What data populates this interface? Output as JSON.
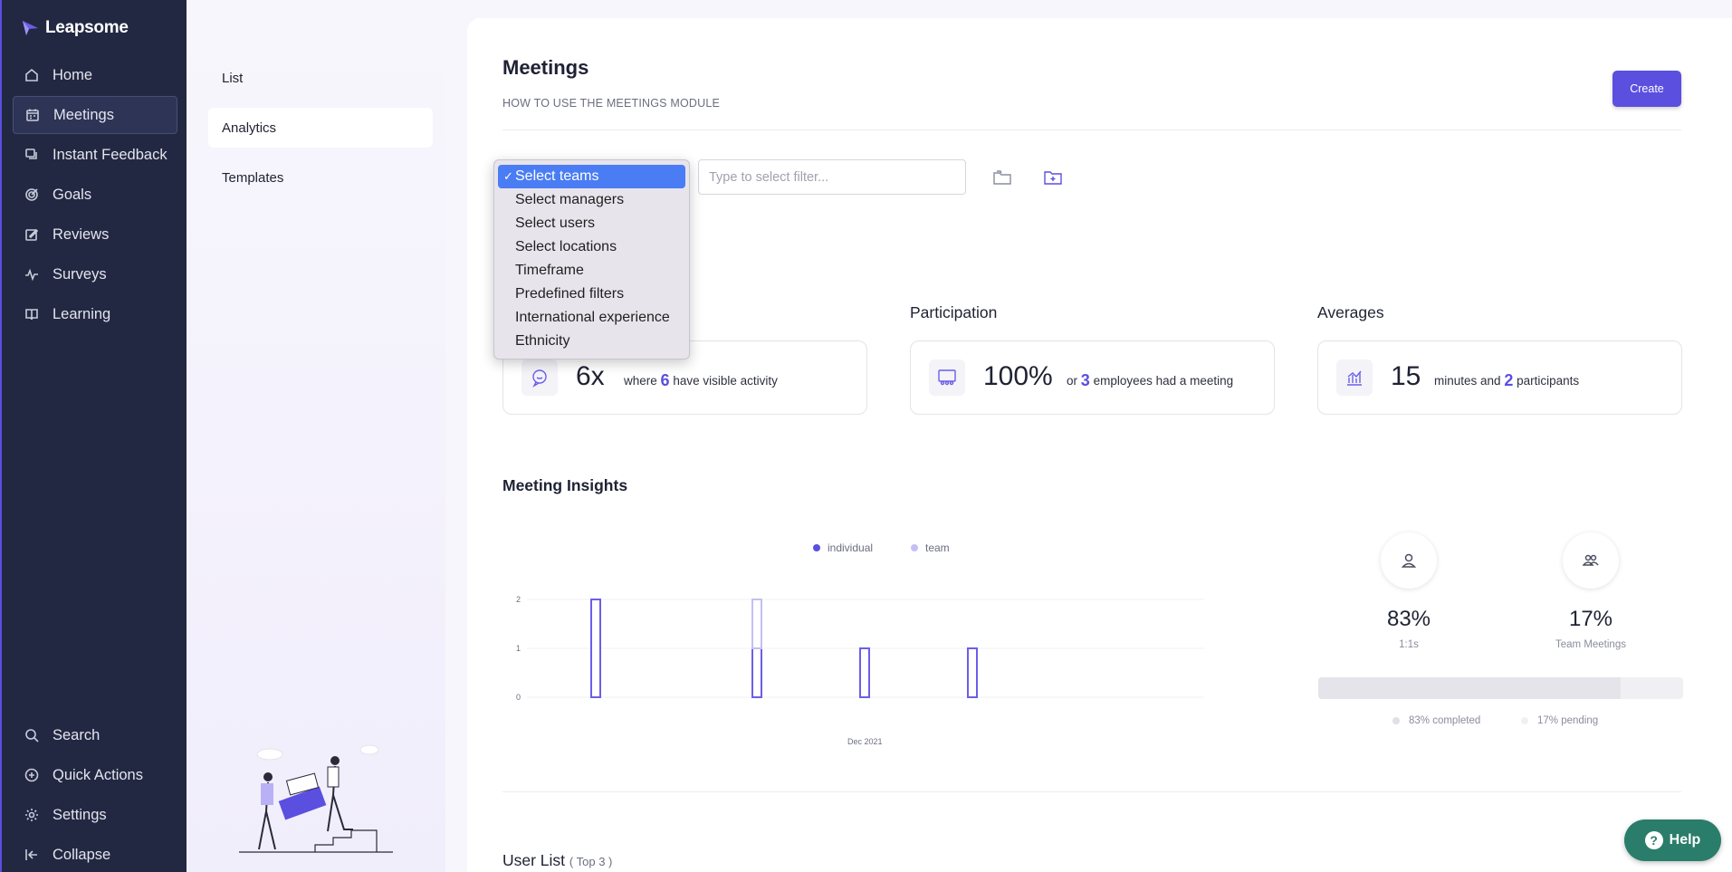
{
  "app": {
    "name": "Leapsome"
  },
  "sidebar": {
    "items": [
      {
        "label": "Home",
        "icon": "home-icon"
      },
      {
        "label": "Meetings",
        "icon": "calendar-icon",
        "active": true
      },
      {
        "label": "Instant Feedback",
        "icon": "feedback-icon"
      },
      {
        "label": "Goals",
        "icon": "target-icon"
      },
      {
        "label": "Reviews",
        "icon": "edit-icon"
      },
      {
        "label": "Surveys",
        "icon": "pulse-icon"
      },
      {
        "label": "Learning",
        "icon": "book-icon"
      }
    ],
    "bottom": [
      {
        "label": "Search",
        "icon": "search-icon"
      },
      {
        "label": "Quick Actions",
        "icon": "plus-circle-icon"
      },
      {
        "label": "Settings",
        "icon": "gear-icon"
      },
      {
        "label": "Collapse",
        "icon": "collapse-icon"
      }
    ]
  },
  "subnav": {
    "items": [
      {
        "label": "List"
      },
      {
        "label": "Analytics",
        "active": true
      },
      {
        "label": "Templates"
      }
    ]
  },
  "main": {
    "title": "Meetings",
    "help_link": "HOW TO USE THE MEETINGS MODULE",
    "create_label": "Create",
    "filter_placeholder": "Type to select filter..."
  },
  "dropdown": {
    "selected": "Select teams",
    "options": [
      "Select teams",
      "Select managers",
      "Select users",
      "Select locations",
      "Timeframe",
      "Predefined filters",
      "International experience",
      "Ethnicity"
    ]
  },
  "stats": {
    "participation_label": "Participation",
    "averages_label": "Averages",
    "card1": {
      "big": "6x",
      "pre": "where",
      "num": "6",
      "post": "have visible activity"
    },
    "card2": {
      "big": "100%",
      "pre": "or",
      "num": "3",
      "post": "employees had a meeting"
    },
    "card3": {
      "big": "15",
      "pre": "minutes and",
      "num": "2",
      "post": "participants"
    }
  },
  "insights": {
    "title": "Meeting Insights",
    "one_on_one_pct": "83%",
    "one_on_one_label": "1:1s",
    "team_pct": "17%",
    "team_label": "Team Meetings",
    "completed_label": "83% completed",
    "pending_label": "17% pending",
    "completed_fraction": 0.83
  },
  "chart_data": {
    "type": "bar",
    "series": [
      {
        "name": "individual",
        "values": [
          2,
          1,
          1,
          1
        ],
        "color": "#6b5ee8"
      },
      {
        "name": "team",
        "values": [
          0,
          1,
          0,
          0
        ],
        "color": "#c4bff5"
      }
    ],
    "xlabel": "Dec 2021",
    "y_ticks": [
      "0",
      "1",
      "2"
    ],
    "ylim": [
      0,
      2
    ]
  },
  "userlist": {
    "title": "User List",
    "sub": "( Top 3 )"
  },
  "help": {
    "label": "Help"
  },
  "colors": {
    "accent": "#5b4fe0",
    "sidebar": "#232842",
    "help": "#2a7d6b"
  }
}
